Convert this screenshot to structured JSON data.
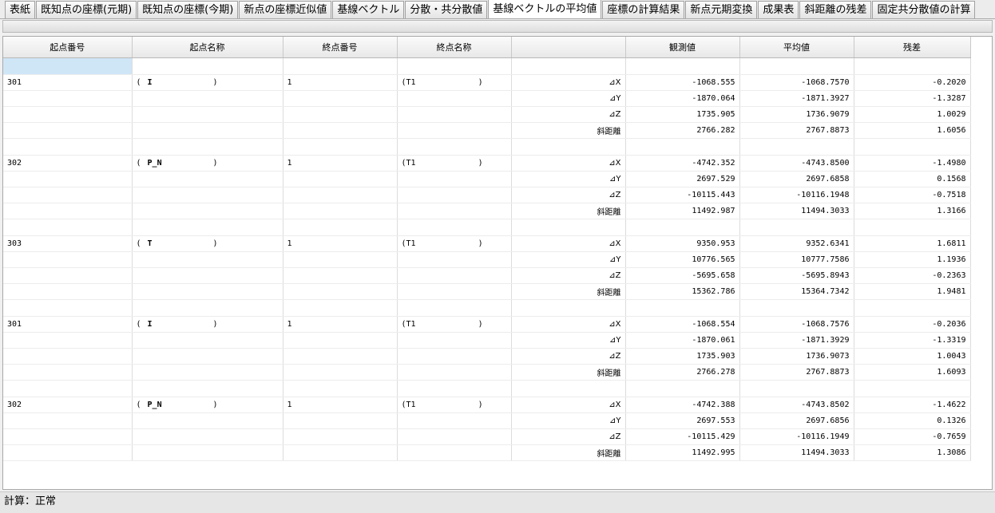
{
  "tabs": [
    {
      "label": "表紙",
      "active": false
    },
    {
      "label": "既知点の座標(元期)",
      "active": false
    },
    {
      "label": "既知点の座標(今期)",
      "active": false
    },
    {
      "label": "新点の座標近似値",
      "active": false
    },
    {
      "label": "基線ベクトル",
      "active": false
    },
    {
      "label": "分散・共分散値",
      "active": false
    },
    {
      "label": "基線ベクトルの平均値",
      "active": true
    },
    {
      "label": "座標の計算結果",
      "active": false
    },
    {
      "label": "新点元期変換",
      "active": false
    },
    {
      "label": "成果表",
      "active": false
    },
    {
      "label": "斜距離の残差",
      "active": false
    },
    {
      "label": "固定共分散値の計算",
      "active": false
    }
  ],
  "table": {
    "headers": [
      "起点番号",
      "起点名称",
      "終点番号",
      "終点名称",
      "",
      "観測値",
      "平均値",
      "残差"
    ],
    "groups": [
      {
        "start_no": "301",
        "start_name": "I",
        "end_no": "1",
        "end_name": "T1",
        "rows": [
          {
            "comp": "⊿X",
            "obs": "-1068.555",
            "avg": "-1068.7570",
            "res": "-0.2020"
          },
          {
            "comp": "⊿Y",
            "obs": "-1870.064",
            "avg": "-1871.3927",
            "res": "-1.3287"
          },
          {
            "comp": "⊿Z",
            "obs": "1735.905",
            "avg": "1736.9079",
            "res": "1.0029"
          },
          {
            "comp": "斜距離",
            "obs": "2766.282",
            "avg": "2767.8873",
            "res": "1.6056"
          }
        ]
      },
      {
        "start_no": "302",
        "start_name": "P_N",
        "end_no": "1",
        "end_name": "T1",
        "rows": [
          {
            "comp": "⊿X",
            "obs": "-4742.352",
            "avg": "-4743.8500",
            "res": "-1.4980"
          },
          {
            "comp": "⊿Y",
            "obs": "2697.529",
            "avg": "2697.6858",
            "res": "0.1568"
          },
          {
            "comp": "⊿Z",
            "obs": "-10115.443",
            "avg": "-10116.1948",
            "res": "-0.7518"
          },
          {
            "comp": "斜距離",
            "obs": "11492.987",
            "avg": "11494.3033",
            "res": "1.3166"
          }
        ]
      },
      {
        "start_no": "303",
        "start_name": "T",
        "end_no": "1",
        "end_name": "T1",
        "rows": [
          {
            "comp": "⊿X",
            "obs": "9350.953",
            "avg": "9352.6341",
            "res": "1.6811"
          },
          {
            "comp": "⊿Y",
            "obs": "10776.565",
            "avg": "10777.7586",
            "res": "1.1936"
          },
          {
            "comp": "⊿Z",
            "obs": "-5695.658",
            "avg": "-5695.8943",
            "res": "-0.2363"
          },
          {
            "comp": "斜距離",
            "obs": "15362.786",
            "avg": "15364.7342",
            "res": "1.9481"
          }
        ]
      },
      {
        "start_no": "301",
        "start_name": "I",
        "end_no": "1",
        "end_name": "T1",
        "rows": [
          {
            "comp": "⊿X",
            "obs": "-1068.554",
            "avg": "-1068.7576",
            "res": "-0.2036"
          },
          {
            "comp": "⊿Y",
            "obs": "-1870.061",
            "avg": "-1871.3929",
            "res": "-1.3319"
          },
          {
            "comp": "⊿Z",
            "obs": "1735.903",
            "avg": "1736.9073",
            "res": "1.0043"
          },
          {
            "comp": "斜距離",
            "obs": "2766.278",
            "avg": "2767.8873",
            "res": "1.6093"
          }
        ]
      },
      {
        "start_no": "302",
        "start_name": "P_N",
        "end_no": "1",
        "end_name": "T1",
        "rows": [
          {
            "comp": "⊿X",
            "obs": "-4742.388",
            "avg": "-4743.8502",
            "res": "-1.4622"
          },
          {
            "comp": "⊿Y",
            "obs": "2697.553",
            "avg": "2697.6856",
            "res": "0.1326"
          },
          {
            "comp": "⊿Z",
            "obs": "-10115.429",
            "avg": "-10116.1949",
            "res": "-0.7659"
          },
          {
            "comp": "斜距離",
            "obs": "11492.995",
            "avg": "11494.3033",
            "res": "1.3086"
          }
        ]
      }
    ]
  },
  "status": "計算：正常"
}
